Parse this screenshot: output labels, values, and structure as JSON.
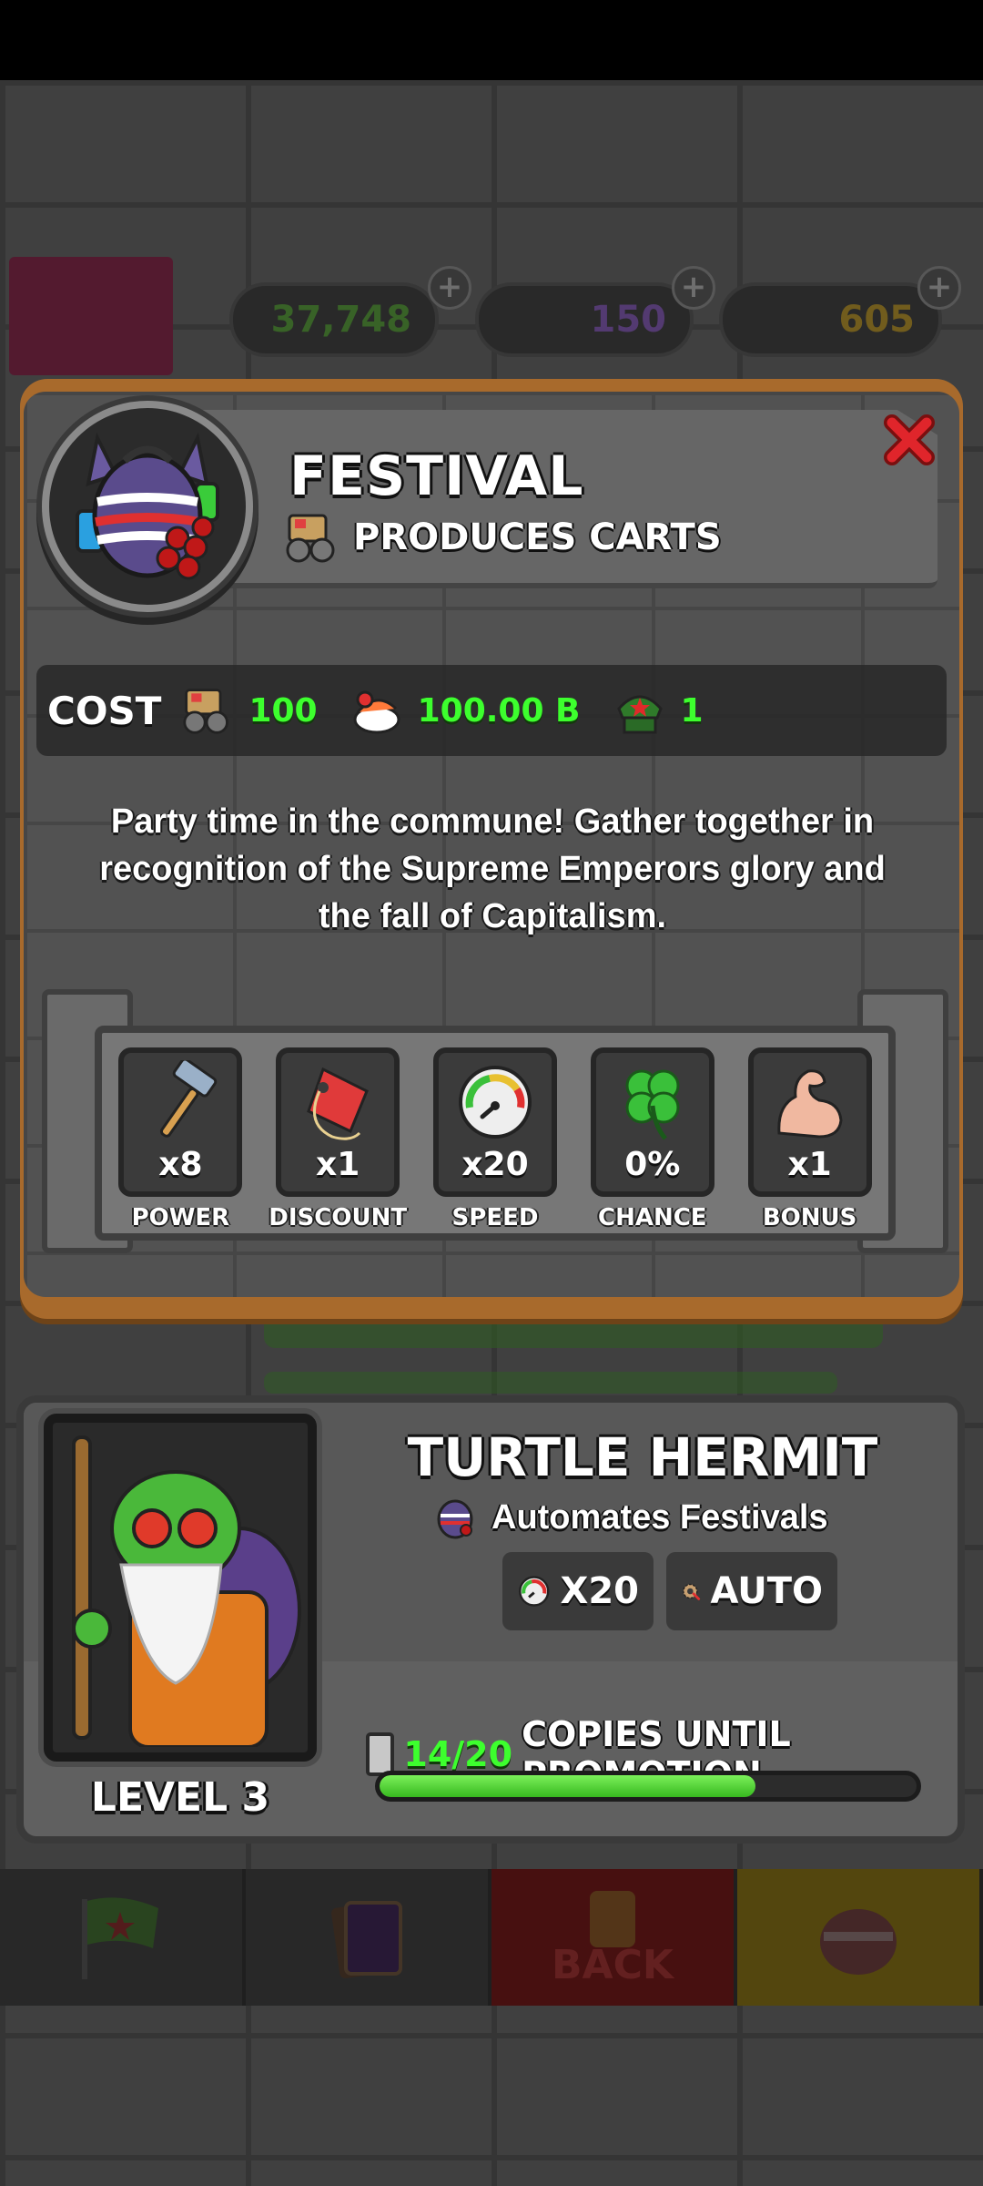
{
  "hud": {
    "resource1": "37,748",
    "resource2": "150",
    "resource3": "605"
  },
  "bottom_nav": {
    "back_label": "BACK"
  },
  "building": {
    "title": "FESTIVAL",
    "produces": "PRODUCES CARTS",
    "cost_label": "COST",
    "costs": [
      "100",
      "100.00 B",
      "1"
    ],
    "description": "Party time in the commune! Gather together in recognition of the Supreme Emperors glory and the fall of Capitalism.",
    "stats": [
      {
        "value": "x8",
        "label": "POWER",
        "icon": "hammer-icon"
      },
      {
        "value": "x1",
        "label": "DISCOUNT",
        "icon": "price-tag-icon"
      },
      {
        "value": "x20",
        "label": "SPEED",
        "icon": "speedometer-icon"
      },
      {
        "value": "0%",
        "label": "CHANCE",
        "icon": "four-leaf-clover-icon"
      },
      {
        "value": "x1",
        "label": "BONUS",
        "icon": "flexed-bicep-icon"
      }
    ]
  },
  "worker": {
    "name": "TURTLE HERMIT",
    "automates": "Automates Festivals",
    "speed": "X20",
    "mode": "AUTO",
    "level": "LEVEL 3",
    "copies": "14/20",
    "copies_text": "COPIES UNTIL PROMOTION",
    "progress": 0.7
  },
  "colors": {
    "accent_green": "#3dff2e",
    "card_border": "#a86a2c",
    "close_red": "#e0252b"
  }
}
